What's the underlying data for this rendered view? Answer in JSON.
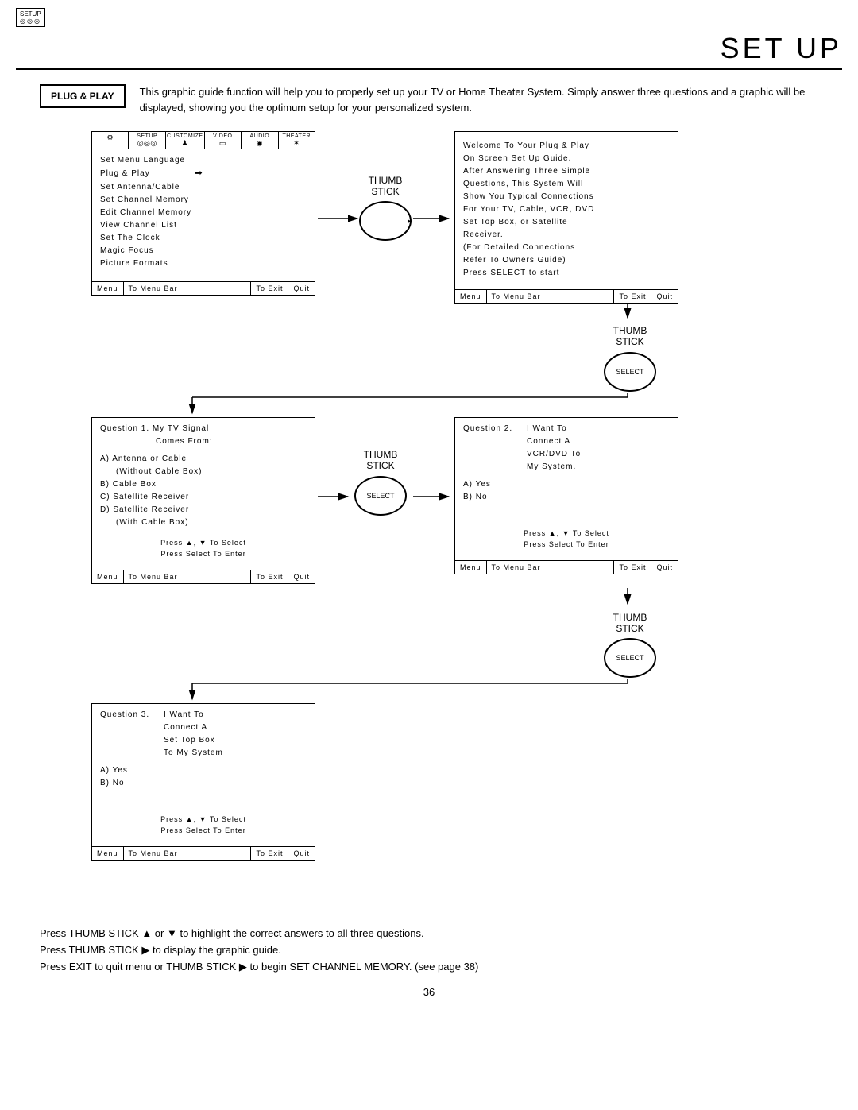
{
  "top_icon_label": "SETUP",
  "header_title": "SET UP",
  "plugplay_label": "PLUG & PLAY",
  "intro_text": "This graphic guide function will help you to properly set up your TV or Home Theater System.  Simply answer three questions and a graphic will be displayed, showing you the optimum setup for your personalized system.",
  "menu_tabs": {
    "t1": "SETUP",
    "t2": "CUSTOMIZE",
    "t3": "VIDEO",
    "t4": "AUDIO",
    "t5": "THEATER"
  },
  "panel1_items": {
    "i1": "Set Menu Language",
    "i2": "Plug & Play",
    "i3": "Set Antenna/Cable",
    "i4": "Set Channel Memory",
    "i5": "Edit Channel Memory",
    "i6": "View Channel List",
    "i7": "Set The Clock",
    "i8": "Magic Focus",
    "i9": "Picture Formats"
  },
  "panel2": {
    "l1": "Welcome To Your Plug & Play",
    "l2": "On Screen Set Up Guide.",
    "l3": "After Answering Three Simple",
    "l4": "Questions, This System Will",
    "l5": "Show You Typical Connections",
    "l6": "For Your TV, Cable, VCR, DVD",
    "l7": "Set Top Box, or Satellite",
    "l8": "Receiver.",
    "l9": "(For Detailed Connections",
    "l10": "Refer To Owners Guide)",
    "l11": "Press SELECT to start"
  },
  "panel3": {
    "q": "Question 1.  My TV Signal",
    "q2": "Comes From:",
    "a": "A) Antenna or Cable",
    "a2": "(Without Cable Box)",
    "b": "B) Cable Box",
    "c": "C) Satellite Receiver",
    "d": "D) Satellite Receiver",
    "d2": "(With Cable Box)"
  },
  "panel4": {
    "q": "Question 2.",
    "r1": "I Want To",
    "r2": "Connect A",
    "r3": "VCR/DVD To",
    "r4": "My System.",
    "a": "A) Yes",
    "b": "B) No"
  },
  "panel5": {
    "q": "Question 3.",
    "r1": "I Want To",
    "r2": "Connect A",
    "r3": "Set Top Box",
    "r4": "To My System",
    "a": "A) Yes",
    "b": "B) No"
  },
  "hints": {
    "select": "Press ▲, ▼ To Select",
    "enter": "Press Select To Enter"
  },
  "footer": {
    "menu": "Menu",
    "to_menu_bar": "To Menu Bar",
    "to_exit": "To Exit",
    "quit": "Quit"
  },
  "thumb_label": "THUMB\nSTICK",
  "select_label": "SELECT",
  "instructions": {
    "l1": "Press  THUMB STICK ▲ or ▼ to highlight the correct answers to all three questions.",
    "l2": "Press THUMB STICK ▶ to display the graphic guide.",
    "l3": "Press EXIT to quit menu or THUMB STICK ▶ to begin SET CHANNEL MEMORY. (see page 38)"
  },
  "page_number": "36"
}
